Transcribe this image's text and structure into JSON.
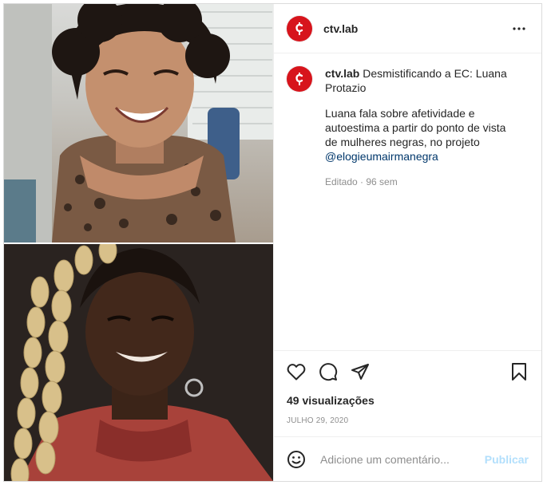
{
  "header": {
    "username": "ctv.lab",
    "avatar_icon": "ctv-logo-icon",
    "more_icon": "more-options-icon"
  },
  "caption": {
    "author": "ctv.lab",
    "title": "Desmistificando a EC: Luana Protazio",
    "description": "Luana fala sobre afetividade e autoestima a partir do ponto de vista de mulheres negras, no projeto",
    "mention": "@elogieumairmanegra",
    "edited": "Editado",
    "time": "96 sem"
  },
  "actions": {
    "like_icon": "heart-icon",
    "comment_icon": "comment-icon",
    "share_icon": "send-icon",
    "save_icon": "bookmark-icon"
  },
  "stats": {
    "views": "49 visualizações",
    "date": "JULHO 29, 2020"
  },
  "comment": {
    "emoji_icon": "emoji-icon",
    "placeholder": "Adicione um comentário...",
    "publish_label": "Publicar"
  },
  "colors": {
    "brand": "#d7141c",
    "link": "#00376b",
    "muted": "#8e8e8e",
    "publish_disabled": "#b2dffc"
  }
}
